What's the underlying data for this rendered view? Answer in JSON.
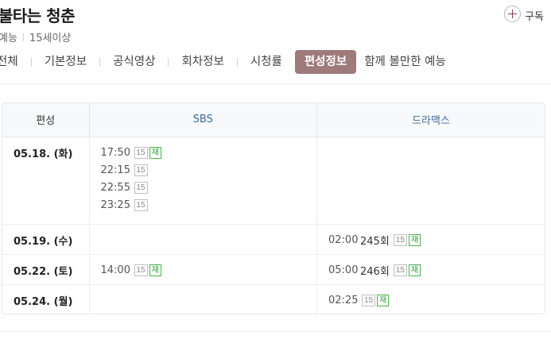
{
  "program": {
    "title": "불타는 청춘",
    "genre": "예능",
    "rating": "15세이상"
  },
  "subscribe": {
    "label": "구독"
  },
  "tabs": [
    "전체",
    "기본정보",
    "공식영상",
    "회차정보",
    "시청률",
    "편성정보",
    "함께 볼만한 예능"
  ],
  "active_tab": "편성정보",
  "schedule": {
    "headers": {
      "date": "편성",
      "ch1": "SBS",
      "ch2": "드라맥스"
    },
    "rows": [
      {
        "date": "05.18. (화)",
        "ch1": [
          {
            "time": "17:50",
            "rating": "15",
            "rerun": "재"
          },
          {
            "time": "22:15",
            "rating": "15"
          },
          {
            "time": "22:55",
            "rating": "15"
          },
          {
            "time": "23:25",
            "rating": "15"
          }
        ],
        "ch2": []
      },
      {
        "date": "05.19. (수)",
        "ch1": [],
        "ch2": [
          {
            "time": "02:00",
            "episode": "245회",
            "rating": "15",
            "rerun": "재"
          }
        ]
      },
      {
        "date": "05.22. (토)",
        "ch1": [
          {
            "time": "14:00",
            "rating": "15",
            "rerun": "재"
          }
        ],
        "ch2": [
          {
            "time": "05:00",
            "episode": "246회",
            "rating": "15",
            "rerun": "재"
          }
        ]
      },
      {
        "date": "05.24. (월)",
        "ch1": [],
        "ch2": [
          {
            "time": "02:25",
            "rating": "15",
            "rerun": "재"
          }
        ]
      }
    ]
  }
}
